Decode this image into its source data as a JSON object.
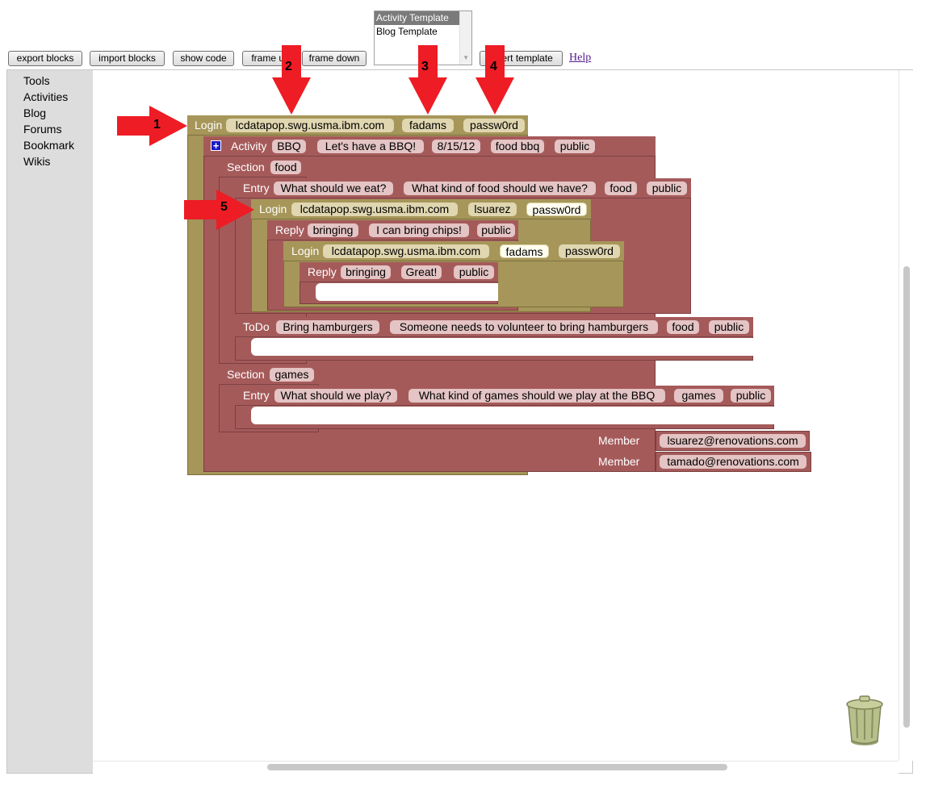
{
  "toolbar": {
    "export_blocks": "export blocks",
    "import_blocks": "import blocks",
    "show_code": "show code",
    "frame_up": "frame up",
    "frame_down": "frame down",
    "insert_template": "insert template",
    "help": "Help"
  },
  "templates": {
    "options": [
      "Activity Template",
      "Blog Template"
    ],
    "selected": "Activity Template"
  },
  "toolbox": {
    "items": [
      "Tools",
      "Activities",
      "Blog",
      "Forums",
      "Bookmark",
      "Wikis"
    ]
  },
  "blocks": {
    "login1": {
      "label": "Login",
      "server": "lcdatapop.swg.usma.ibm.com",
      "user": "fadams",
      "password": "passw0rd"
    },
    "activity": {
      "label": "Activity",
      "name": "BBQ",
      "description": "Let's have a BBQ!",
      "date": "8/15/12",
      "tags": "food bbq",
      "visibility": "public"
    },
    "section1": {
      "label": "Section",
      "name": "food"
    },
    "entry1": {
      "label": "Entry",
      "title": "What should we eat?",
      "description": "What kind of food should we have?",
      "tags": "food",
      "visibility": "public"
    },
    "login2": {
      "label": "Login",
      "server": "lcdatapop.swg.usma.ibm.com",
      "user": "lsuarez",
      "password": "passw0rd"
    },
    "reply1": {
      "label": "Reply",
      "tag": "bringing",
      "text": "I can bring chips!",
      "visibility": "public"
    },
    "login3": {
      "label": "Login",
      "server": "lcdatapop.swg.usma.ibm.com",
      "user": "fadams",
      "password": "passw0rd"
    },
    "reply2": {
      "label": "Reply",
      "tag": "bringing",
      "text": "Great!",
      "visibility": "public"
    },
    "todo": {
      "label": "ToDo",
      "title": "Bring hamburgers",
      "description": "Someone needs to volunteer to bring hamburgers",
      "tags": "food",
      "visibility": "public"
    },
    "section2": {
      "label": "Section",
      "name": "games"
    },
    "entry2": {
      "label": "Entry",
      "title": "What should we play?",
      "description": "What kind of games should we play at the BBQ",
      "tags": "games",
      "visibility": "public"
    },
    "member1": {
      "label": "Member",
      "email": "lsuarez@renovations.com"
    },
    "member2": {
      "label": "Member",
      "email": "tamado@renovations.com"
    }
  },
  "callouts": [
    "1",
    "2",
    "3",
    "4",
    "5"
  ],
  "colors": {
    "login_block": "#a69659",
    "activity_block": "#a55a5a",
    "callout_arrow": "#ee1c24"
  },
  "icons": [
    "plus-icon",
    "trash-icon",
    "scroll-down-arrow-icon"
  ]
}
